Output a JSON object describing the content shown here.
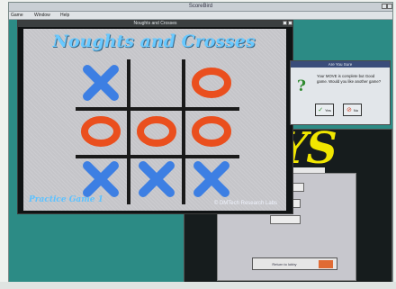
{
  "app": {
    "title": "ScoreBird",
    "menu": [
      "Game",
      "Window",
      "Help"
    ]
  },
  "game_window": {
    "title": "Noughts and Crosses",
    "heading": "Noughts and Crosses",
    "footer_left": "Practice Game 1",
    "footer_right": "© DMTech Research Labs"
  },
  "board": {
    "cells": [
      "X",
      "",
      "O",
      "O",
      "O",
      "O",
      "X",
      "X",
      "X"
    ]
  },
  "dialog": {
    "title": "Are You Sure",
    "message": "Your MOVE is complete but Good game. Would you like another game?",
    "yes_label": "Yes",
    "no_label": "No"
  },
  "back_window": {
    "bottom_button": "Return to lobby"
  },
  "colors": {
    "x_mark": "#3d7fe3",
    "o_mark": "#ea4f1e",
    "heading": "#69c9ff",
    "logo": "#f1e600",
    "background": "#2c8b85"
  },
  "icons": {
    "dialog_icon": "question-icon",
    "yes_icon": "check-icon",
    "no_icon": "no-icon"
  }
}
